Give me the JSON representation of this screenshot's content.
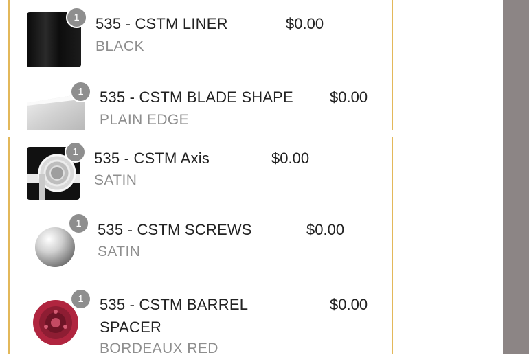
{
  "items": [
    {
      "qty": "1",
      "name": "535 - CSTM LINER",
      "price": "$0.00",
      "option": "BLACK",
      "thumb_icon": "black-liner-swatch"
    },
    {
      "qty": "1",
      "name": "535 - CSTM BLADE SHAPE",
      "price": "$0.00",
      "option": "PLAIN EDGE",
      "thumb_icon": "plain-edge-blade"
    },
    {
      "qty": "1",
      "name": "535 - CSTM Axis",
      "price": "$0.00",
      "option": "SATIN",
      "thumb_icon": "satin-axis-lock"
    },
    {
      "qty": "1",
      "name": "535 - CSTM SCREWS",
      "price": "$0.00",
      "option": "SATIN",
      "thumb_icon": "satin-screw"
    },
    {
      "qty": "1",
      "name": "535 - CSTM BARREL SPACER",
      "price": "$0.00",
      "option": "BORDEAUX RED",
      "thumb_icon": "bordeaux-barrel-spacer"
    }
  ],
  "colors": {
    "accent_line": "#e3b85a",
    "badge": "#8e8e8e",
    "scroll_track": "#8c8585",
    "option_text": "#8e8e8e"
  }
}
